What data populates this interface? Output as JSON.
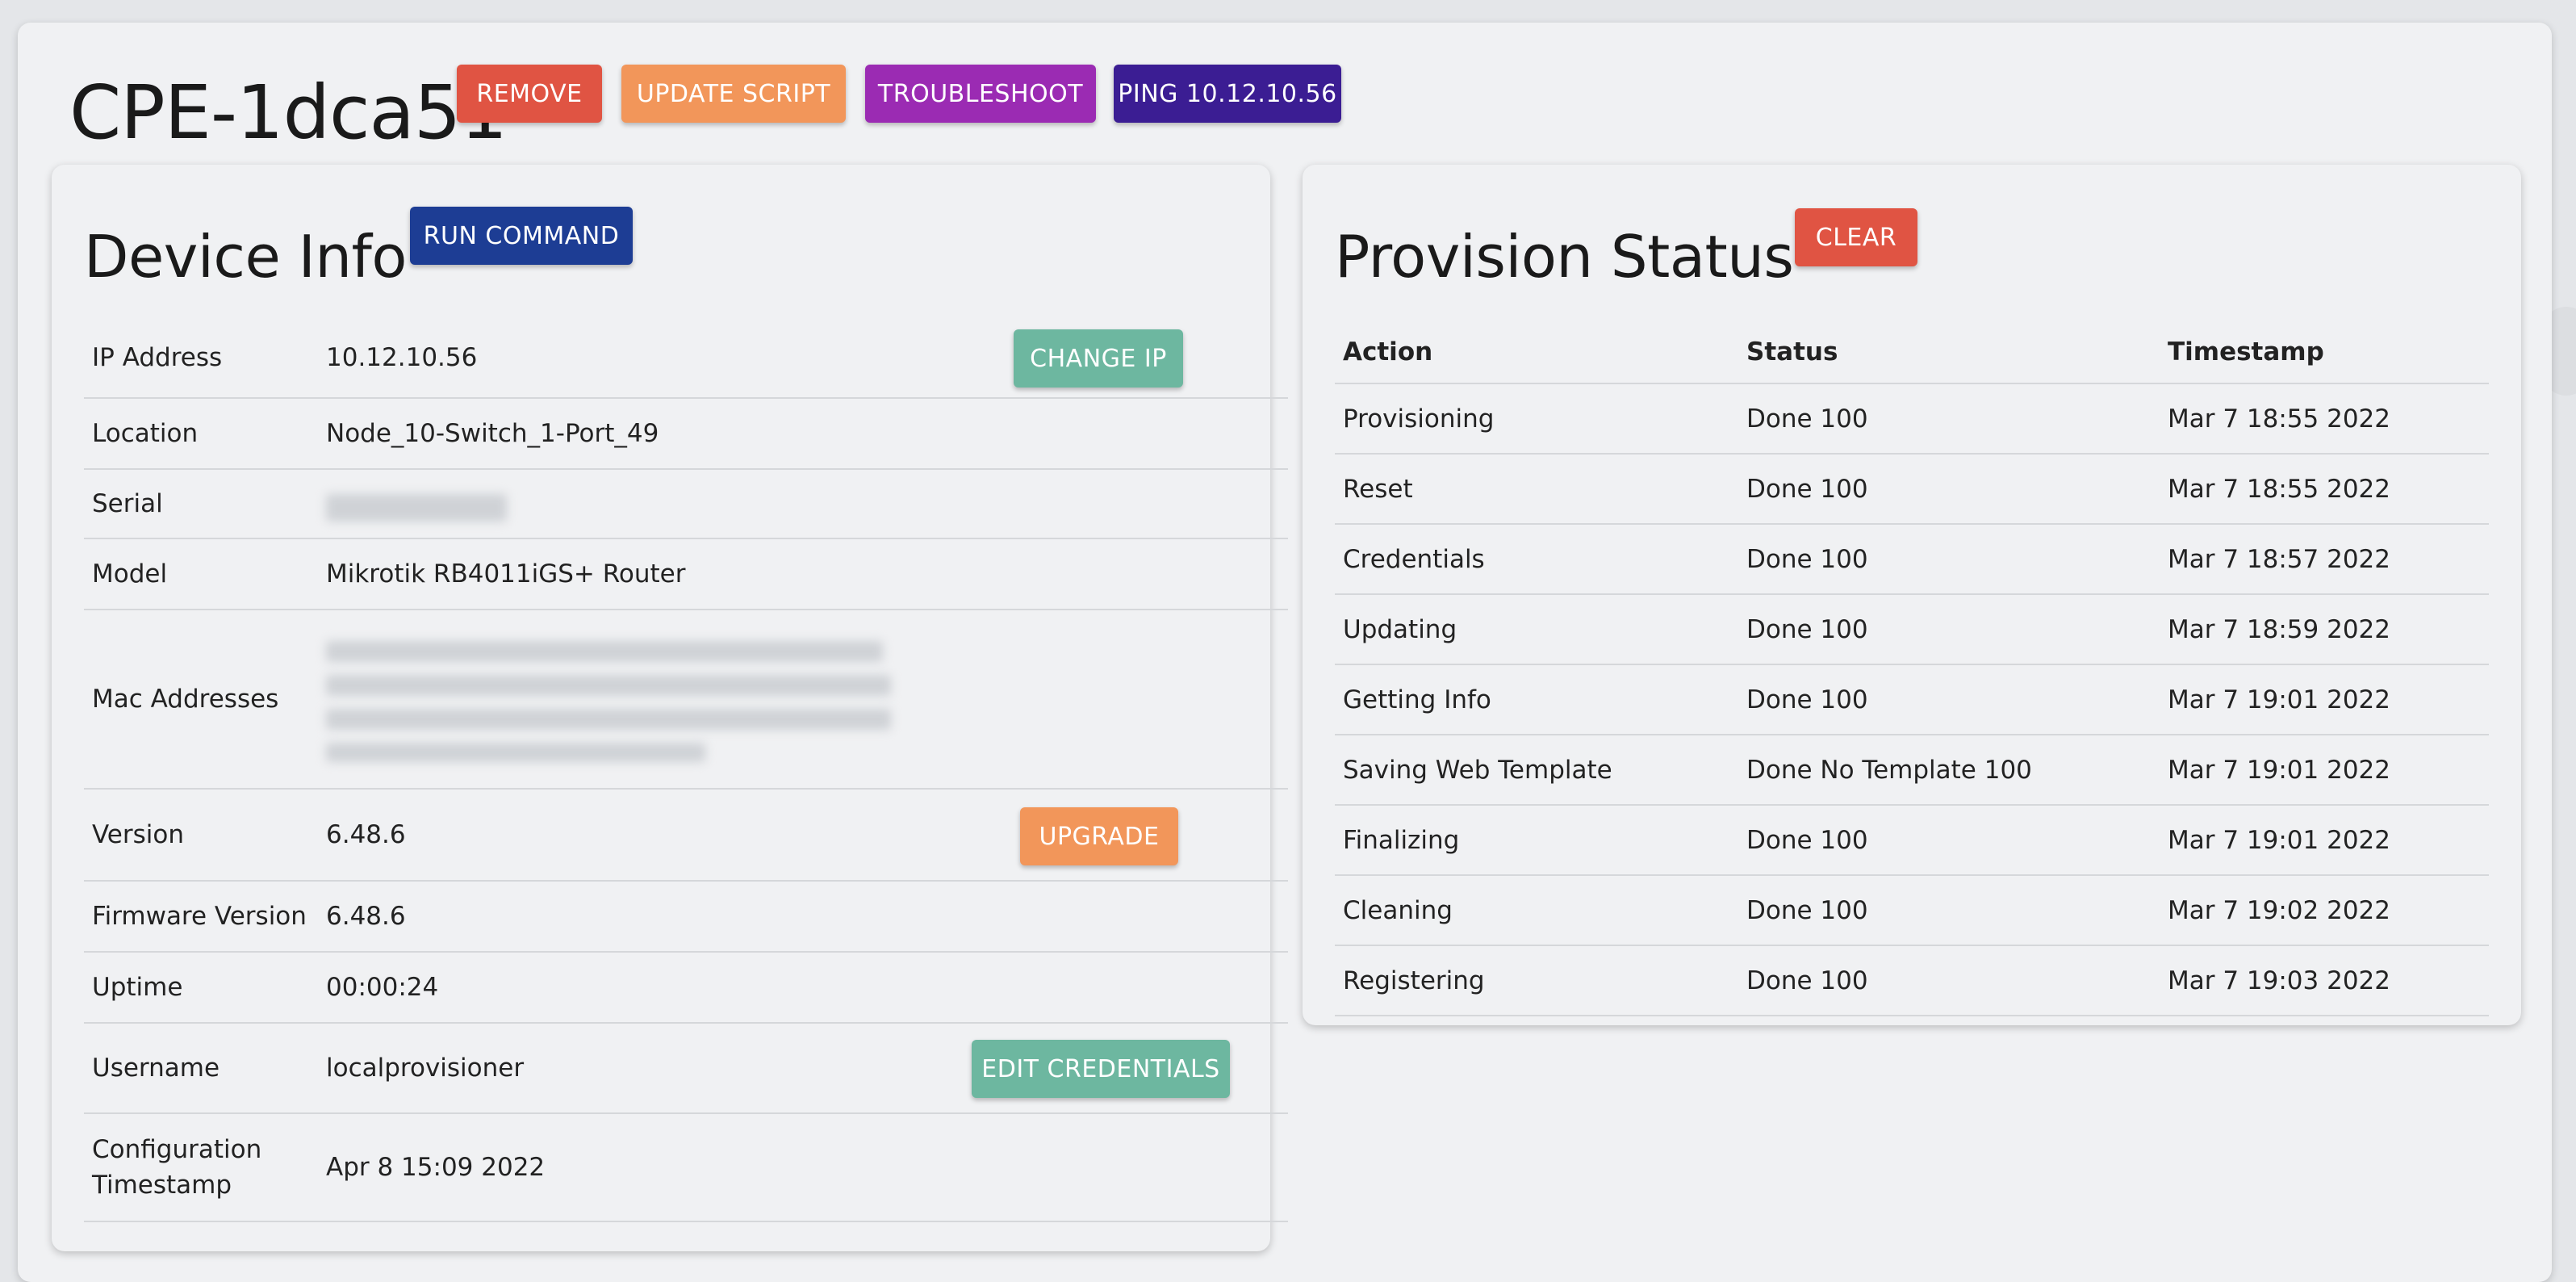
{
  "header": {
    "title": "CPE-1dca51",
    "buttons": {
      "remove": "REMOVE",
      "update_script": "UPDATE SCRIPT",
      "troubleshoot": "TROUBLESHOOT",
      "ping": "PING 10.12.10.56"
    }
  },
  "device_info": {
    "title": "Device Info",
    "run_command": "RUN COMMAND",
    "rows": {
      "ip": {
        "label": "IP Address",
        "value": "10.12.10.56",
        "action": "CHANGE IP"
      },
      "location": {
        "label": "Location",
        "value": "Node_10-Switch_1-Port_49"
      },
      "serial": {
        "label": "Serial"
      },
      "model": {
        "label": "Model",
        "value": "Mikrotik RB4011iGS+ Router"
      },
      "mac": {
        "label": "Mac Addresses"
      },
      "version": {
        "label": "Version",
        "value": "6.48.6",
        "action": "UPGRADE"
      },
      "firmware": {
        "label": "Firmware Version",
        "value": "6.48.6"
      },
      "uptime": {
        "label": "Uptime",
        "value": "00:00:24"
      },
      "username": {
        "label": "Username",
        "value": "localprovisioner",
        "action": "EDIT CREDENTIALS"
      },
      "config_ts": {
        "label_line1": "Configuration",
        "label_line2": "Timestamp",
        "value": "Apr 8 15:09 2022"
      }
    }
  },
  "provision_status": {
    "title": "Provision Status",
    "clear": "CLEAR",
    "columns": [
      "Action",
      "Status",
      "Timestamp"
    ],
    "rows": [
      [
        "Provisioning",
        "Done 100",
        "Mar 7 18:55 2022"
      ],
      [
        "Reset",
        "Done 100",
        "Mar 7 18:55 2022"
      ],
      [
        "Credentials",
        "Done 100",
        "Mar 7 18:57 2022"
      ],
      [
        "Updating",
        "Done 100",
        "Mar 7 18:59 2022"
      ],
      [
        "Getting Info",
        "Done 100",
        "Mar 7 19:01 2022"
      ],
      [
        "Saving Web Template",
        "Done No Template 100",
        "Mar 7 19:01 2022"
      ],
      [
        "Finalizing",
        "Done 100",
        "Mar 7 19:01 2022"
      ],
      [
        "Cleaning",
        "Done 100",
        "Mar 7 19:02 2022"
      ],
      [
        "Registering",
        "Done 100",
        "Mar 7 19:03 2022"
      ]
    ]
  },
  "colors": {
    "red": "#e05443",
    "orange": "#f2965a",
    "purple": "#9b2bb3",
    "indigo": "#3b1d93",
    "blue": "#1d3d94",
    "teal": "#6db7a0"
  }
}
